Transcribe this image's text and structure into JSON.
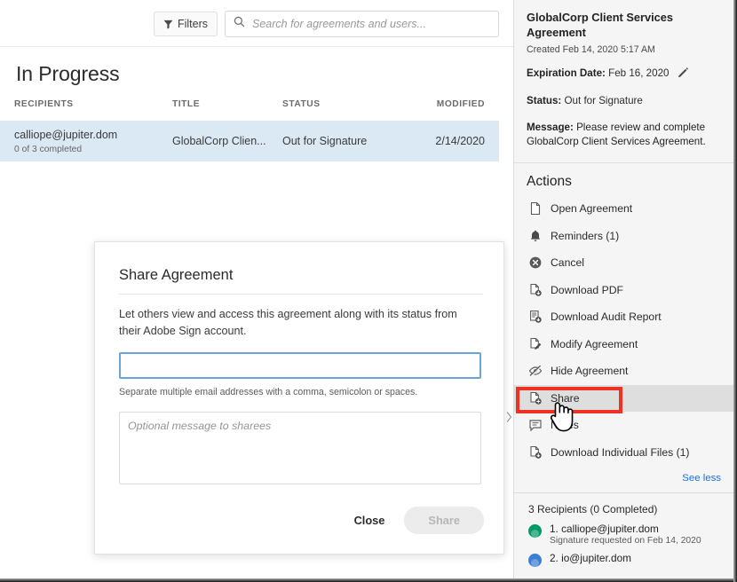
{
  "toolbar": {
    "filters_label": "Filters",
    "filter_icon": "funnel-icon",
    "search_icon": "search-icon",
    "search_placeholder": "Search for agreements and users...",
    "search_value": ""
  },
  "main": {
    "page_title": "In Progress",
    "columns": [
      "RECIPIENTS",
      "TITLE",
      "STATUS",
      "MODIFIED"
    ],
    "rows": [
      {
        "recipient": "calliope@jupiter.dom",
        "recipient_sub": "0 of 3 completed",
        "title": "GlobalCorp Clien...",
        "status": "Out for Signature",
        "modified": "2/14/2020",
        "selected": true
      }
    ]
  },
  "dialog": {
    "title": "Share Agreement",
    "description": "Let others view and access this agreement along with its status from their Adobe Sign account.",
    "email_value": "",
    "email_placeholder": "",
    "hint": "Separate multiple email addresses with a comma, semicolon or spaces.",
    "message_placeholder": "Optional message to sharees",
    "message_value": "",
    "close_label": "Close",
    "share_label": "Share",
    "share_disabled": true
  },
  "panel": {
    "agreement_title": "GlobalCorp Client Services Agreement",
    "created": "Created Feb 14, 2020 5:17 AM",
    "expiration_label": "Expiration Date:",
    "expiration_value": "Feb 16, 2020",
    "edit_icon": "pencil-icon",
    "status_label": "Status:",
    "status_value": "Out for Signature",
    "message_label": "Message:",
    "message_value": "Please review and complete GlobalCorp Client Services Agreement.",
    "actions_title": "Actions",
    "actions": [
      {
        "label": "Open Agreement",
        "icon": "document-icon"
      },
      {
        "label": "Reminders (1)",
        "icon": "bell-icon"
      },
      {
        "label": "Cancel",
        "icon": "cancel-circle-icon"
      },
      {
        "label": "Download PDF",
        "icon": "document-download-icon"
      },
      {
        "label": "Download Audit Report",
        "icon": "report-download-icon"
      },
      {
        "label": "Modify Agreement",
        "icon": "document-edit-icon"
      },
      {
        "label": "Hide Agreement",
        "icon": "eye-off-icon"
      },
      {
        "label": "Share",
        "icon": "document-share-icon",
        "hovered": true,
        "highlighted": true
      },
      {
        "label": "Notes",
        "icon": "note-icon"
      },
      {
        "label": "Download Individual Files (1)",
        "icon": "document-download-icon"
      }
    ],
    "see_less_label": "See less",
    "recipients_header": "3 Recipients (0 Completed)",
    "recipients": [
      {
        "name": "1. calliope@jupiter.dom",
        "sub": "Signature requested on Feb 14, 2020",
        "color": "#009b67"
      },
      {
        "name": "2. io@jupiter.dom",
        "sub": "",
        "color": "#3a7fd5"
      }
    ],
    "collapse_icon": "chevron-right-icon"
  },
  "annotation": {
    "highlight_color": "#ee3124",
    "cursor_icon": "hand-pointer-cursor"
  }
}
